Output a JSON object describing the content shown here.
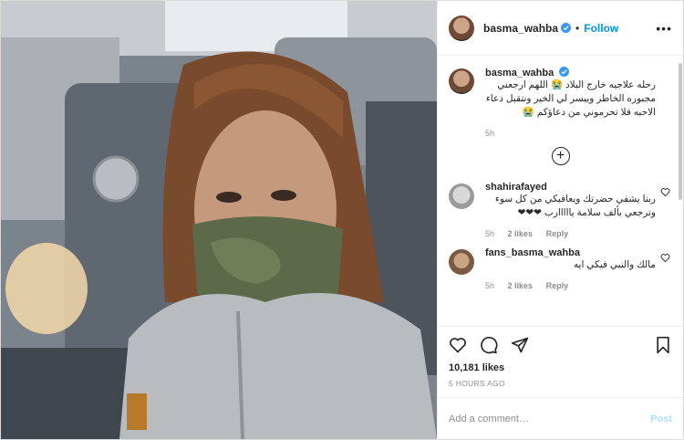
{
  "post": {
    "username": "basma_wahba",
    "follow_label": "Follow",
    "more_label": "•••",
    "caption": "رحله علاجيه خارج البلاد 😭 اللهم ارجعني مجبوره الخاطر وييسر لي الخير ونتقبل دعاء الاحبه فلا تحرموني من دعاؤكم 😭",
    "caption_time": "5h",
    "likes": "10,181 likes",
    "timestamp": "5 HOURS AGO",
    "comment_placeholder": "Add a comment…",
    "post_label": "Post"
  },
  "comments": [
    {
      "user": "shahirafayed",
      "text": "ربنا يشفي حضرتك ويعافيكي من كل سوء وترجعي بألف سلامة يااااارب ❤❤❤",
      "time": "5h",
      "likes": "2 likes",
      "reply": "Reply"
    },
    {
      "user": "fans_basma_wahba",
      "text": "مالك والنبي فيكي ايه",
      "time": "5h",
      "likes": "2 likes",
      "reply": "Reply"
    }
  ],
  "icons": [
    "heart-icon",
    "comment-icon",
    "share-icon",
    "bookmark-icon",
    "load-more-icon",
    "verified-icon"
  ],
  "colors": {
    "accent": "#0095f6",
    "post_disabled": "#b2dffc",
    "text": "#262626",
    "muted": "#8e8e8e"
  }
}
